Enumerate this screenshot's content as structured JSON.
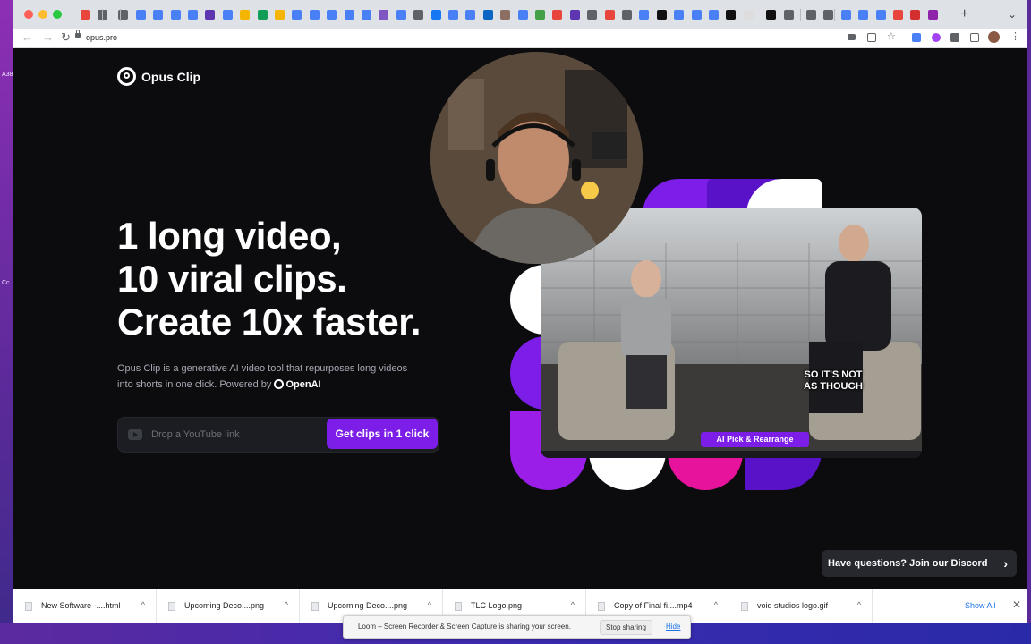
{
  "browser": {
    "url": "opus.pro",
    "new_tab": "+",
    "tab_caret": "⌄",
    "nav": {
      "back": "←",
      "forward": "→",
      "reload": "↻"
    }
  },
  "desktop": {
    "labels": [
      "A38",
      "Cc"
    ]
  },
  "site": {
    "brand": "Opus Clip",
    "headline": [
      "1 long video,",
      "10 viral clips.",
      "Create 10x faster."
    ],
    "description": "Opus Clip is a generative AI video tool that repurposes long videos into shorts in one click. Powered by",
    "powered_by": "OpenAI",
    "input_placeholder": "Drop a YouTube link",
    "cta": "Get clips in 1 click",
    "video_caption_line1": "SO IT'S NOT",
    "video_caption_line2": "AS THOUGH",
    "ai_badge": "AI Pick & Rearrange",
    "discord": "Have questions? Join our Discord",
    "discord_chevron": "›"
  },
  "colors": {
    "accent": "#7d1de8",
    "magenta": "#e8139c",
    "background": "#0c0c0f"
  },
  "downloads": {
    "items": [
      {
        "name": "New Software -....html"
      },
      {
        "name": "Upcoming Deco....png"
      },
      {
        "name": "Upcoming Deco....png"
      },
      {
        "name": "TLC Logo.png"
      },
      {
        "name": "Copy of Final fi....mp4"
      },
      {
        "name": "void studios logo.gif"
      }
    ],
    "caret": "^",
    "show_all": "Show All",
    "close": "✕"
  },
  "loom_bar": {
    "message": "Loom – Screen Recorder & Screen Capture is sharing your screen.",
    "stop": "Stop sharing",
    "hide": "Hide"
  }
}
